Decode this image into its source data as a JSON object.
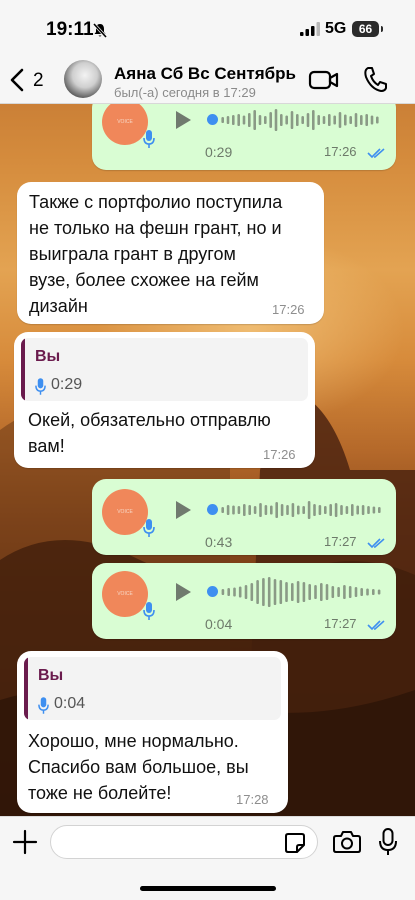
{
  "status_bar": {
    "time": "19:11",
    "network": "5G",
    "battery": "66"
  },
  "header": {
    "back_count": "2",
    "contact_name": "Аяна Сб Вс Сентябрь",
    "contact_status": "был(-а) сегодня в 17:29"
  },
  "voice_waveforms": {
    "played_color": "#3e8ff0",
    "bar_color": "#8a9a86"
  },
  "messages": [
    {
      "type": "voice",
      "direction": "outgoing",
      "duration": "0:29",
      "time": "17:26",
      "read": true
    },
    {
      "type": "text",
      "direction": "incoming",
      "lines": [
        "Также с портфолио поступила",
        "не только на фешн грант, но и",
        "выиграла грант в другом",
        "вузе, более схожее на гейм",
        "дизайн"
      ],
      "time": "17:26"
    },
    {
      "type": "reply",
      "direction": "incoming",
      "quote_author": "Вы",
      "quote_duration": "0:29",
      "lines": [
        "Окей, обязательно отправлю",
        "вам!"
      ],
      "time": "17:26"
    },
    {
      "type": "voice",
      "direction": "outgoing",
      "duration": "0:43",
      "time": "17:27",
      "read": true
    },
    {
      "type": "voice",
      "direction": "outgoing",
      "duration": "0:04",
      "time": "17:27",
      "read": true
    },
    {
      "type": "reply",
      "direction": "incoming",
      "quote_author": "Вы",
      "quote_duration": "0:04",
      "lines": [
        "Хорошо, мне нормально.",
        "Спасибо вам большое, вы",
        "тоже не болейте!"
      ],
      "time": "17:28"
    }
  ],
  "input": {
    "placeholder": ""
  },
  "colors": {
    "outgoing_bubble": "#d9fdd3",
    "incoming_bubble": "#ffffff",
    "read_ticks": "#3e8ff0",
    "quote_accent": "#6a1b4d"
  }
}
